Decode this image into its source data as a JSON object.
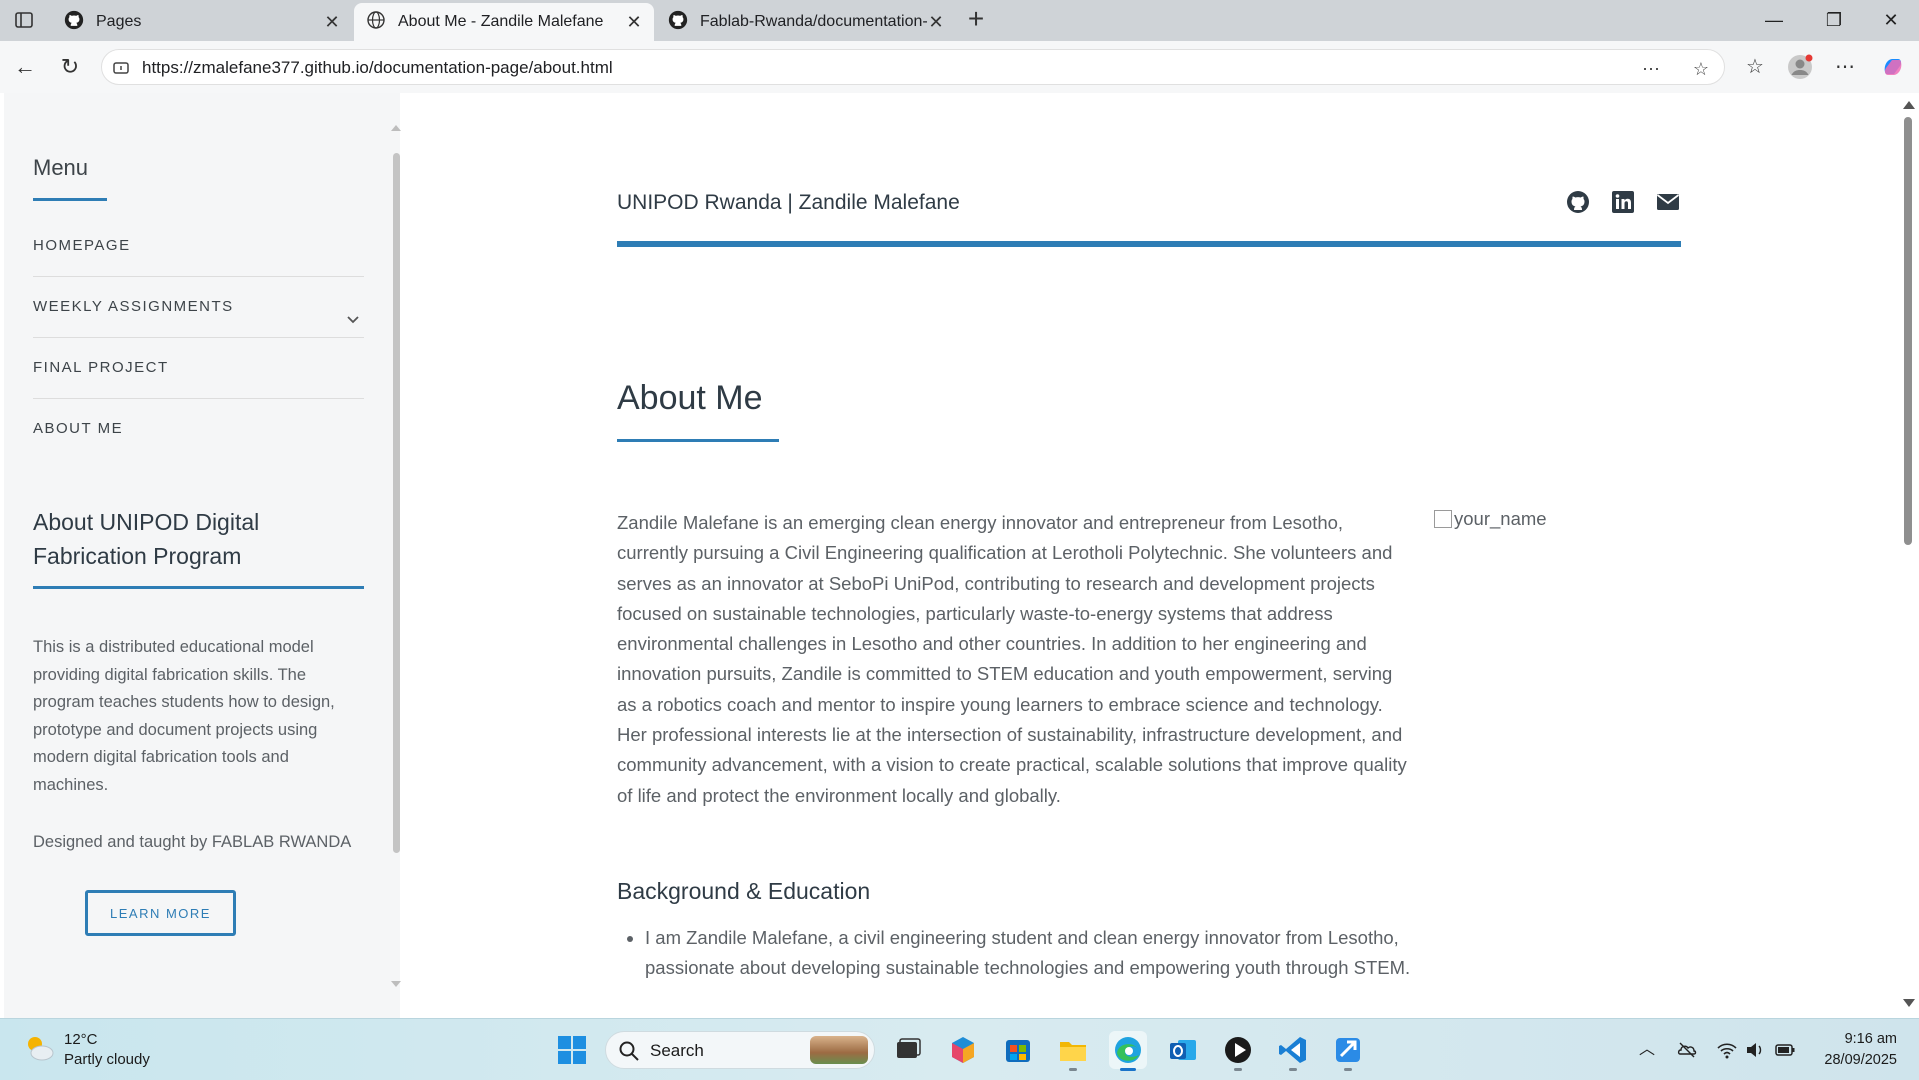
{
  "browser": {
    "tabs": [
      {
        "title": "Pages",
        "icon": "github-icon",
        "active": false
      },
      {
        "title": "About Me - Zandile Malefane",
        "icon": "globe-icon",
        "active": true
      },
      {
        "title": "Fablab-Rwanda/documentation-p",
        "icon": "github-icon",
        "active": false
      }
    ],
    "url": "https://zmalefane377.github.io/documentation-page/about.html"
  },
  "sidebar": {
    "menu_title": "Menu",
    "items": [
      {
        "label": "HOMEPAGE",
        "has_submenu": false
      },
      {
        "label": "WEEKLY ASSIGNMENTS",
        "has_submenu": true
      },
      {
        "label": "FINAL PROJECT",
        "has_submenu": false
      },
      {
        "label": "ABOUT ME",
        "has_submenu": false
      }
    ],
    "heading": "About UNIPOD Digital Fabrication Program",
    "description": "This is a distributed educational model providing digital fabrication skills. The program teaches students how to design, prototype and document projects using modern digital fabrication tools and machines.",
    "credit": "Designed and taught by FABLAB RWANDA",
    "button_label": "LEARN MORE"
  },
  "header": {
    "site_title": "UNIPOD Rwanda | Zandile Malefane",
    "social_icons": [
      "github-icon",
      "linkedin-icon",
      "envelope-icon"
    ]
  },
  "main": {
    "title": "About Me",
    "intro": "Zandile Malefane is an emerging clean energy innovator and entrepreneur from Lesotho, currently pursuing a Civil Engineering qualification at Lerotholi Polytechnic. She volunteers and serves as an innovator at SeboPi UniPod, contributing to research and development projects focused on sustainable technologies, particularly waste-to-energy systems that address environmental challenges in Lesotho and other countries. In addition to her engineering and innovation pursuits, Zandile is committed to STEM education and youth empowerment, serving as a robotics coach and mentor to inspire young learners to embrace science and technology. Her professional interests lie at the intersection of sustainability, infrastructure development, and community advancement, with a vision to create practical, scalable solutions that improve quality of life and protect the environment locally and globally.",
    "image_alt": "your_name",
    "background_title": "Background & Education",
    "background_items": [
      "I am Zandile Malefane, a civil engineering student and clean energy innovator from Lesotho, passionate about developing sustainable technologies and empowering youth through STEM."
    ]
  },
  "taskbar": {
    "weather_temp": "12°C",
    "weather_desc": "Partly cloudy",
    "search_label": "Search",
    "time": "9:16 am",
    "date": "28/09/2025"
  },
  "colors": {
    "accent": "#2e7db5",
    "heading": "#2f3b45",
    "body_text": "#5c6166",
    "sidebar_bg": "#f5f6f7"
  }
}
